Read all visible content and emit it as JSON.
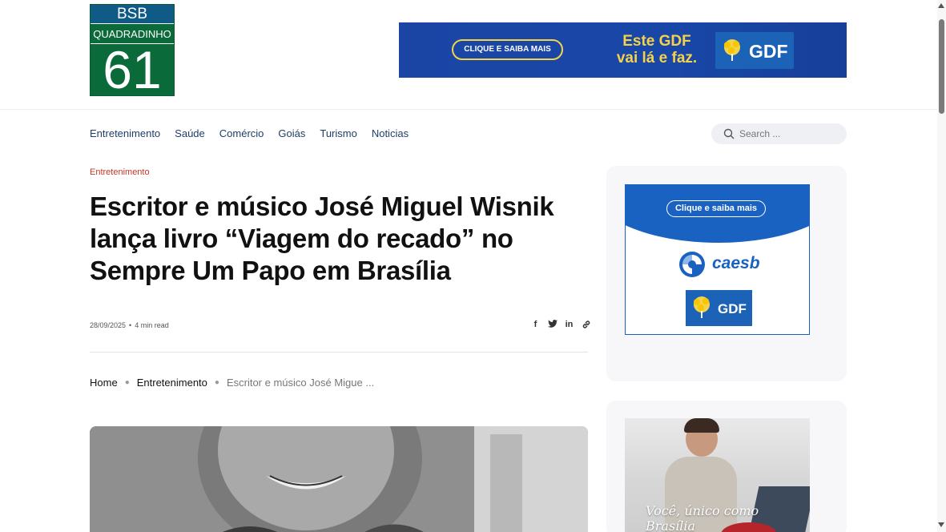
{
  "logo": {
    "line1": "BSB",
    "line2": "QUADRADINHO",
    "number": "61"
  },
  "banner_top": {
    "button": "CLIQUE E SAIBA MAIS",
    "slogan_line1": "Este GDF",
    "slogan_line2": "vai lá e faz.",
    "brand": "GDF"
  },
  "nav": {
    "items": [
      "Entretenimento",
      "Saúde",
      "Comércio",
      "Goiás",
      "Turismo",
      "Noticias"
    ]
  },
  "search": {
    "placeholder": "Search ..."
  },
  "article": {
    "category": "Entretenimento",
    "title": "Escritor e músico José Miguel Wisnik lança livro “Viagem do recado” no Sempre Um Papo em Brasília",
    "date": "28/09/2025",
    "read_time": "4 min read",
    "share": [
      "facebook-icon",
      "twitter-icon",
      "linkedin-icon",
      "link-icon"
    ]
  },
  "breadcrumb": {
    "home": "Home",
    "section": "Entretenimento",
    "current": "Escritor e músico José Migue ..."
  },
  "sidebar_ad1": {
    "button": "Clique e saiba mais",
    "brand1": "caesb",
    "brand2": "GDF"
  },
  "sidebar_ad2": {
    "tagline": "Você, único como Brasília"
  },
  "colors": {
    "nav_link": "#1f3e68",
    "category": "#c0392b",
    "gdf_blue": "#1947a8",
    "gdf_yellow": "#f4d34a",
    "caesb_blue": "#1a62c2"
  }
}
